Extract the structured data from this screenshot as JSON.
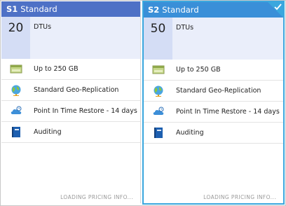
{
  "cards": [
    {
      "tier": "S1",
      "name": "Standard",
      "value": "20",
      "unit": "DTUs",
      "selected": false,
      "features": [
        {
          "icon": "storage-icon",
          "label": "Up to 250 GB"
        },
        {
          "icon": "globe-icon",
          "label": "Standard Geo-Replication"
        },
        {
          "icon": "cloud-restore-icon",
          "label": "Point In Time Restore - 14 days"
        },
        {
          "icon": "auditing-book-icon",
          "label": "Auditing"
        }
      ],
      "status": "LOADING PRICING INFO..."
    },
    {
      "tier": "S2",
      "name": "Standard",
      "value": "50",
      "unit": "DTUs",
      "selected": true,
      "features": [
        {
          "icon": "storage-icon",
          "label": "Up to 250 GB"
        },
        {
          "icon": "globe-icon",
          "label": "Standard Geo-Replication"
        },
        {
          "icon": "cloud-restore-icon",
          "label": "Point In Time Restore - 14 days"
        },
        {
          "icon": "auditing-book-icon",
          "label": "Auditing"
        }
      ],
      "status": "LOADING PRICING INFO..."
    }
  ],
  "colors": {
    "header_s1": "#4e71c6",
    "header_s2": "#3a8fd8",
    "selected_border": "#3aa7de",
    "metric_bg": "#eaeefa",
    "number_bg": "#d4ddf5"
  }
}
